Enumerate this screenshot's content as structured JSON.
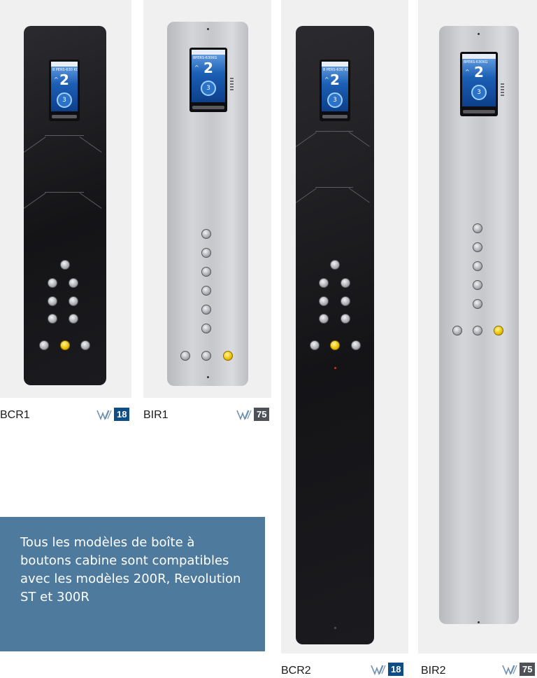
{
  "products": [
    {
      "model": "BCR1",
      "badge": "18",
      "finish": "black"
    },
    {
      "model": "BIR1",
      "badge": "75",
      "finish": "stainless"
    },
    {
      "model": "BCR2",
      "badge": "18",
      "finish": "black"
    },
    {
      "model": "BIR2",
      "badge": "75",
      "finish": "stainless"
    }
  ],
  "display": {
    "subtitle_dark": "8 PERS-630 KG",
    "subtitle_steel": "8PERS-630KG",
    "floor": "2",
    "arrow": "^",
    "dial_number": "3"
  },
  "info_box": {
    "text": "Tous les modèles de boîte à boutons cabine sont compatibles avec les modèles 200R, Revolution ST et 300R"
  },
  "colors": {
    "badge_blue": "#0f4d86",
    "badge_gray": "#4e5257",
    "info_bg": "#4d7a9d",
    "call_button": "#f0c400"
  }
}
